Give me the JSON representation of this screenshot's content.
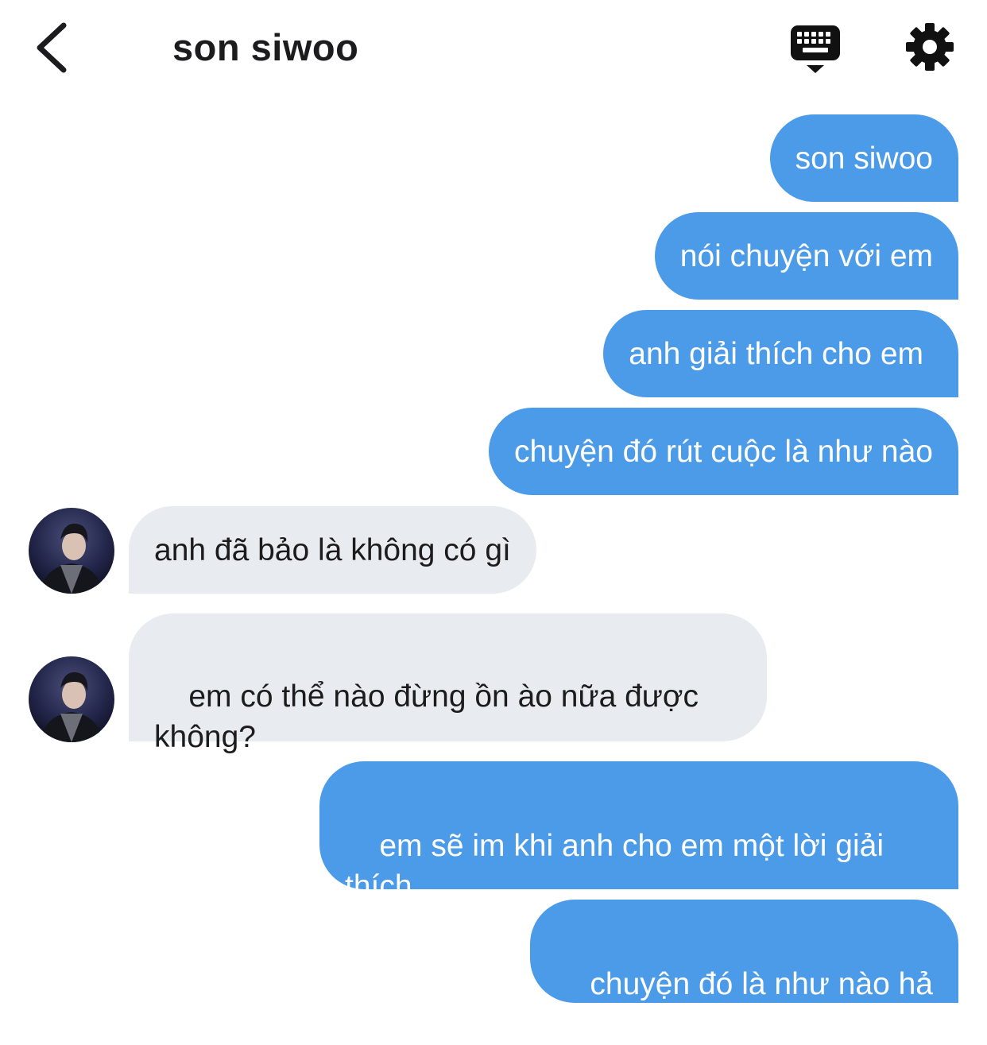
{
  "header": {
    "title": "son siwoo",
    "back_icon": "chevron-left-icon",
    "keyboard_icon": "keyboard-icon",
    "settings_icon": "gear-icon"
  },
  "colors": {
    "outgoing_bubble": "#4c9be8",
    "incoming_bubble": "#e8ebf0"
  },
  "messages": [
    {
      "direction": "out",
      "text": "son siwoo"
    },
    {
      "direction": "out",
      "text": "nói chuyện với em"
    },
    {
      "direction": "out",
      "text": "anh giải thích cho em"
    },
    {
      "direction": "out",
      "text": "chuyện đó rút cuộc là như nào"
    },
    {
      "direction": "in",
      "text": "anh đã bảo là không có gì"
    },
    {
      "direction": "in",
      "text": "em có thể nào đừng ồn ào nữa được\nkhông?"
    },
    {
      "direction": "out",
      "text": "em sẽ im khi anh cho em một lời giải\nthích"
    },
    {
      "direction": "out",
      "text": "chuyện đó là như nào hả"
    }
  ]
}
